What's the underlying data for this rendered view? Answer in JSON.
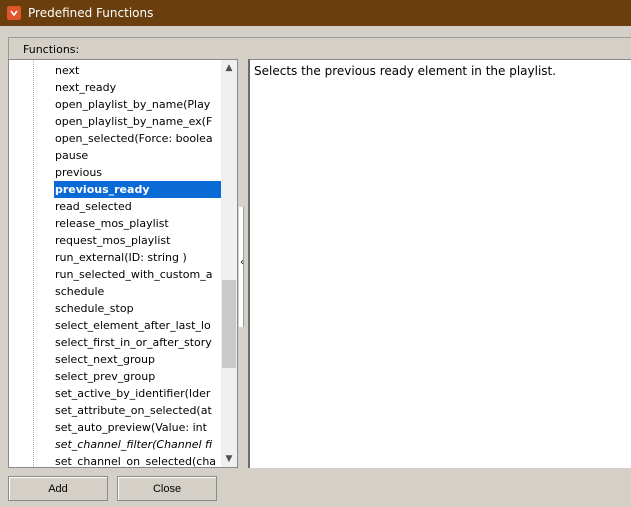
{
  "window": {
    "title": "Predefined Functions"
  },
  "functions_panel": {
    "label": "Functions:"
  },
  "functions_list": [
    {
      "label": "next"
    },
    {
      "label": "next_ready"
    },
    {
      "label": "open_playlist_by_name(Play"
    },
    {
      "label": "open_playlist_by_name_ex(F"
    },
    {
      "label": "open_selected(Force: boolea"
    },
    {
      "label": "pause"
    },
    {
      "label": "previous"
    },
    {
      "label": "previous_ready",
      "selected": true
    },
    {
      "label": "read_selected"
    },
    {
      "label": "release_mos_playlist"
    },
    {
      "label": "request_mos_playlist"
    },
    {
      "label": "run_external(ID: string )"
    },
    {
      "label": "run_selected_with_custom_a"
    },
    {
      "label": "schedule"
    },
    {
      "label": "schedule_stop"
    },
    {
      "label": "select_element_after_last_lo"
    },
    {
      "label": "select_first_in_or_after_story"
    },
    {
      "label": "select_next_group"
    },
    {
      "label": "select_prev_group"
    },
    {
      "label": "set_active_by_identifier(Ider"
    },
    {
      "label": "set_attribute_on_selected(at"
    },
    {
      "label": "set_auto_preview(Value: int"
    },
    {
      "label": "set_channel_filter(Channel fi",
      "italic": true
    },
    {
      "label": "set_channel_on_selected(cha"
    }
  ],
  "description": {
    "text": "Selects the previous ready element in the playlist."
  },
  "buttons": {
    "add": "Add",
    "close": "Close"
  },
  "colors": {
    "titlebar": "#6b3e0e",
    "selection": "#0a6bd6",
    "background": "#d4d0c8"
  }
}
